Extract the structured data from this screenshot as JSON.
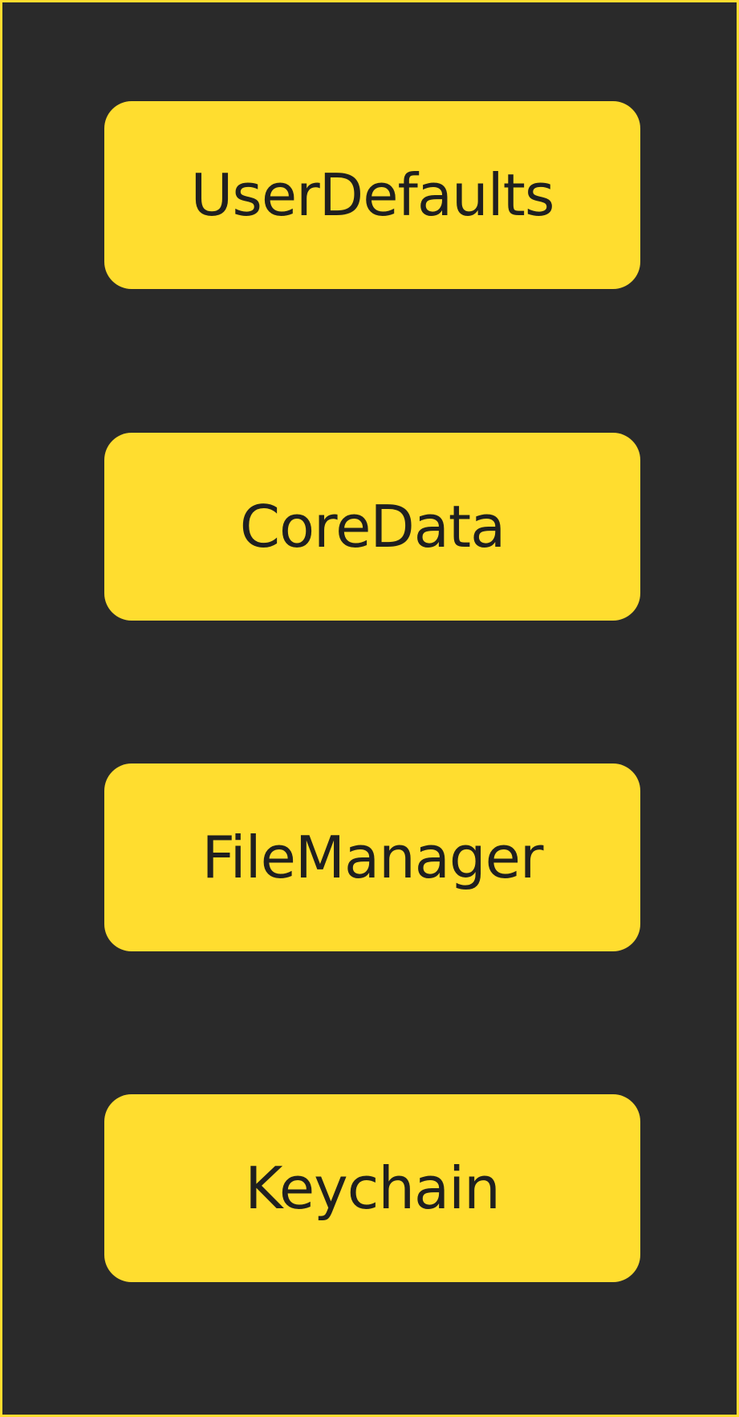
{
  "theme": {
    "background": "#2a2a2a",
    "accent": "#ffdd2f",
    "text": "#1f1f1f"
  },
  "options": [
    {
      "label": "UserDefaults"
    },
    {
      "label": "CoreData"
    },
    {
      "label": "FileManager"
    },
    {
      "label": "Keychain"
    }
  ]
}
